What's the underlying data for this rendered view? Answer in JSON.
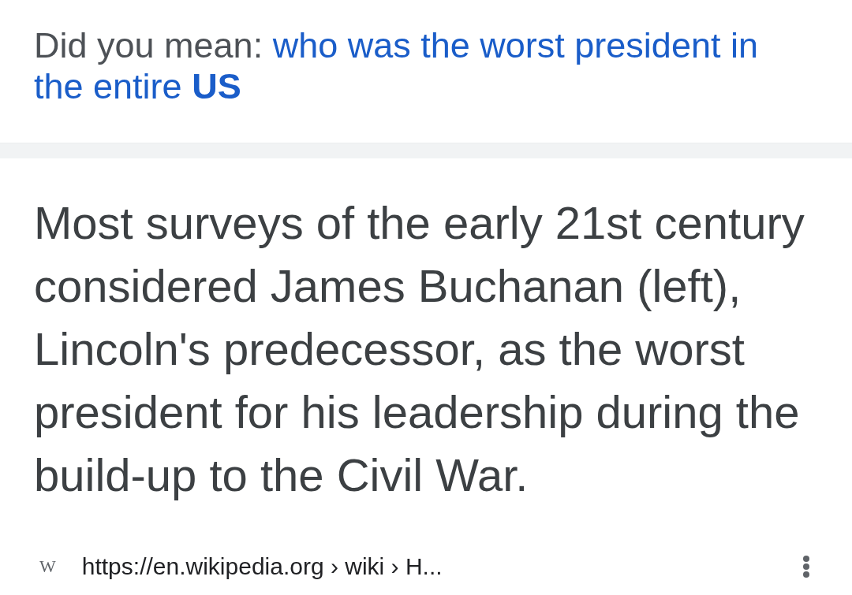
{
  "spelling_suggestion": {
    "label": "Did you mean:",
    "suggestion": [
      "who was the worst president in",
      "the entire **US**"
    ]
  },
  "answer": {
    "text": "Most surveys of the early 21st century considered James Buchanan (left), Lincoln's predecessor, as the worst president for his leadership during the build-up to the Civil War."
  },
  "source": {
    "favicon": "W",
    "url": "https://en.wikipedia.org › wiki › H..."
  }
}
